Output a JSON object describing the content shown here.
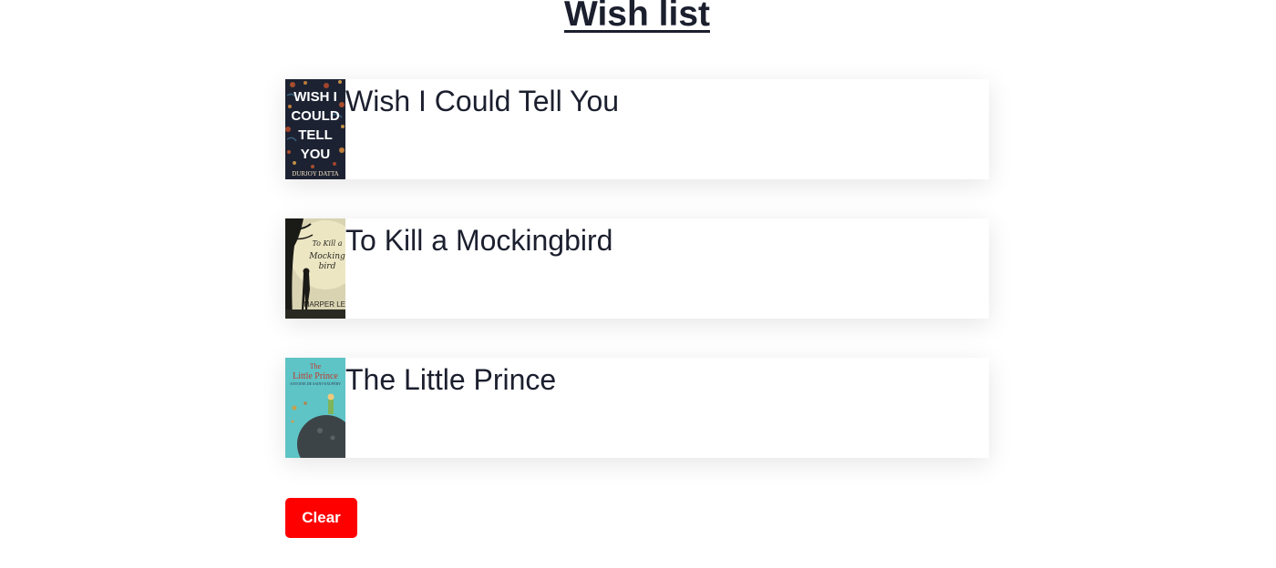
{
  "page": {
    "title": "Wish list"
  },
  "wishlist": {
    "items": [
      {
        "title": "Wish I Could Tell You",
        "cover": {
          "lines": [
            "WISH I",
            "COULD",
            "TELL",
            "YOU"
          ],
          "author": "DURJOY DATTA"
        }
      },
      {
        "title": "To Kill a Mockingbird",
        "cover": {
          "script_lines": [
            "To Kill a",
            "Mockingbird"
          ],
          "author": "HARPER LEE"
        }
      },
      {
        "title": "The Little Prince",
        "cover": {
          "lines": [
            "The",
            "Little Prince"
          ],
          "author": "ANTOINE DE SAINT-EXUPÉRY"
        }
      }
    ]
  },
  "actions": {
    "clear_label": "Clear",
    "clear_color": "#ff0000"
  }
}
